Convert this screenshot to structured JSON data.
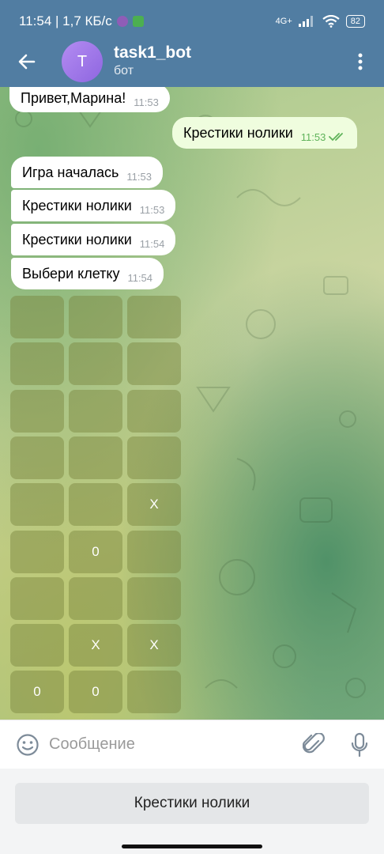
{
  "status": {
    "time_speed": "11:54 | 1,7 КБ/с",
    "network": "4G+",
    "battery": "82"
  },
  "header": {
    "avatar_letter": "T",
    "title": "task1_bot",
    "subtitle": "бот"
  },
  "messages": [
    {
      "text": "Привет,Марина!",
      "time": "11:53",
      "out": false
    },
    {
      "text": "Крестики нолики",
      "time": "11:53",
      "out": true
    },
    {
      "text": "Игра началась",
      "time": "11:53",
      "out": false
    },
    {
      "text": "Крестики нолики",
      "time": "11:53",
      "out": false
    },
    {
      "text": "Крестики нолики",
      "time": "11:54",
      "out": false
    },
    {
      "text": "Выбери клетку",
      "time": "11:54",
      "out": false
    }
  ],
  "board": [
    [
      "",
      "",
      ""
    ],
    [
      "",
      "",
      ""
    ],
    [
      "",
      "",
      ""
    ],
    [
      "",
      "",
      ""
    ],
    [
      "",
      "",
      "X"
    ],
    [
      "",
      "0",
      ""
    ],
    [
      "",
      "",
      ""
    ],
    [
      "",
      "X",
      "X"
    ],
    [
      "0",
      "0",
      ""
    ]
  ],
  "input": {
    "placeholder": "Сообщение"
  },
  "reply_keyboard": {
    "button_label": "Крестики нолики"
  },
  "colors": {
    "header": "#517da2",
    "outgoing_bubble": "#effdde",
    "incoming_bubble": "#ffffff"
  }
}
